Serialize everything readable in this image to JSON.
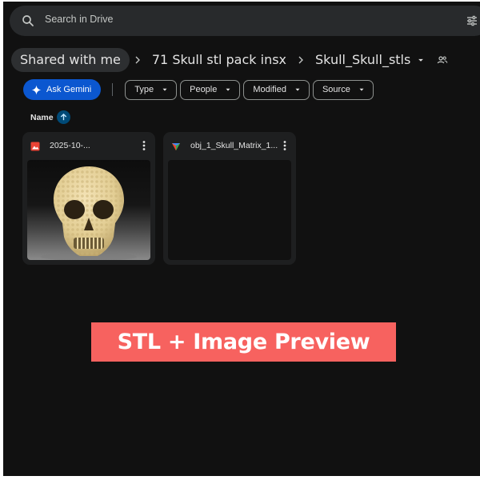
{
  "search": {
    "placeholder": "Search in Drive"
  },
  "breadcrumb": {
    "items": [
      "Shared with me",
      "71 Skull stl pack insx",
      "Skull_Skull_stls"
    ]
  },
  "toolbar": {
    "gemini_label": "Ask Gemini",
    "filters": [
      "Type",
      "People",
      "Modified",
      "Source"
    ]
  },
  "sort": {
    "label": "Name",
    "direction": "ascending"
  },
  "files": [
    {
      "name": "2025-10-...",
      "icon": "image-file-icon",
      "icon_color": "#ea4335",
      "preview": "skull-thumbnail"
    },
    {
      "name": "obj_1_Skull_Matrix_1...",
      "icon": "3d-model-file-icon",
      "preview": "empty"
    }
  ],
  "banner": {
    "text": "STL + Image Preview",
    "background": "#f7625f"
  },
  "colors": {
    "background": "#111111",
    "accent": "#0b57d0",
    "surface": "#1e1f20"
  }
}
